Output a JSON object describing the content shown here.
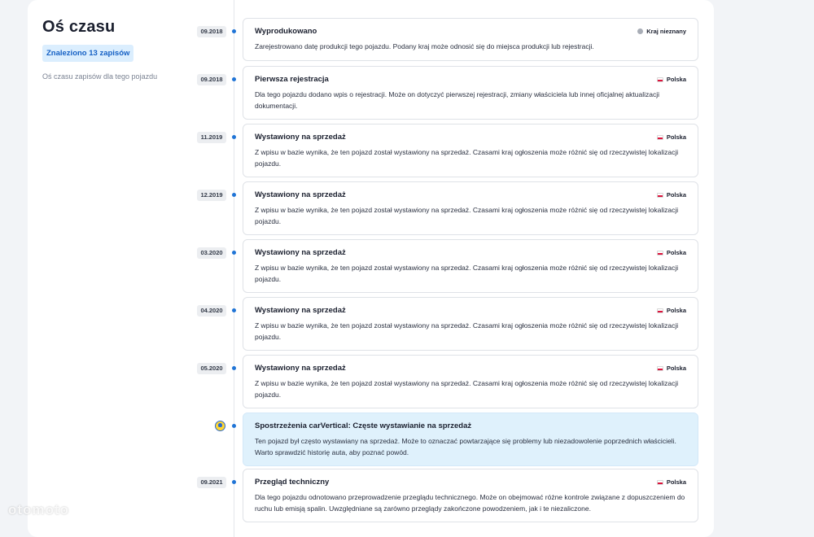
{
  "sidebar": {
    "title": "Oś czasu",
    "count_badge": "Znaleziono 13 zapisów",
    "description": "Oś czasu zapisów dla tego pojazdu"
  },
  "colors": {
    "accent": "#1f74d6",
    "insight_bg": "#dff1fc",
    "badge_bg": "#dbeefe",
    "flag_red": "#dc143c"
  },
  "timeline": [
    {
      "date": "09.2018",
      "title": "Wyprodukowano",
      "country": "Kraj nieznany",
      "flag": "unknown",
      "text": "Zarejestrowano datę produkcji tego pojazdu. Podany kraj może odnosić się do miejsca produkcji lub rejestracji."
    },
    {
      "date": "09.2018",
      "title": "Pierwsza rejestracja",
      "country": "Polska",
      "flag": "pl",
      "text": "Dla tego pojazdu dodano wpis o rejestracji. Może on dotyczyć pierwszej rejestracji, zmiany właściciela lub innej oficjalnej aktualizacji dokumentacji."
    },
    {
      "date": "11.2019",
      "title": "Wystawiony na sprzedaż",
      "country": "Polska",
      "flag": "pl",
      "text": "Z wpisu w bazie wynika, że ten pojazd został wystawiony na sprzedaż. Czasami kraj ogłoszenia może różnić się od rzeczywistej lokalizacji pojazdu."
    },
    {
      "date": "12.2019",
      "title": "Wystawiony na sprzedaż",
      "country": "Polska",
      "flag": "pl",
      "text": "Z wpisu w bazie wynika, że ten pojazd został wystawiony na sprzedaż. Czasami kraj ogłoszenia może różnić się od rzeczywistej lokalizacji pojazdu."
    },
    {
      "date": "03.2020",
      "title": "Wystawiony na sprzedaż",
      "country": "Polska",
      "flag": "pl",
      "text": "Z wpisu w bazie wynika, że ten pojazd został wystawiony na sprzedaż. Czasami kraj ogłoszenia może różnić się od rzeczywistej lokalizacji pojazdu."
    },
    {
      "date": "04.2020",
      "title": "Wystawiony na sprzedaż",
      "country": "Polska",
      "flag": "pl",
      "text": "Z wpisu w bazie wynika, że ten pojazd został wystawiony na sprzedaż. Czasami kraj ogłoszenia może różnić się od rzeczywistej lokalizacji pojazdu."
    },
    {
      "date": "05.2020",
      "title": "Wystawiony na sprzedaż",
      "country": "Polska",
      "flag": "pl",
      "text": "Z wpisu w bazie wynika, że ten pojazd został wystawiony na sprzedaż. Czasami kraj ogłoszenia może różnić się od rzeczywistej lokalizacji pojazdu."
    },
    {
      "date": "",
      "title": "Spostrzeżenia carVertical: Częste wystawianie na sprzedaż",
      "country": "",
      "flag": "none",
      "insight": true,
      "text": "Ten pojazd był często wystawiany na sprzedaż. Może to oznaczać powtarzające się problemy lub niezadowolenie poprzednich właścicieli. Warto sprawdzić historię auta, aby poznać powód."
    },
    {
      "date": "09.2021",
      "title": "Przegląd techniczny",
      "country": "Polska",
      "flag": "pl",
      "text": "Dla tego pojazdu odnotowano przeprowadzenie przeglądu technicznego. Może on obejmować różne kontrole związane z dopuszczeniem do ruchu lub emisją spalin. Uwzględniane są zarówno przeglądy zakończone powodzeniem, jak i te niezaliczone."
    }
  ],
  "watermark": "otomoto"
}
